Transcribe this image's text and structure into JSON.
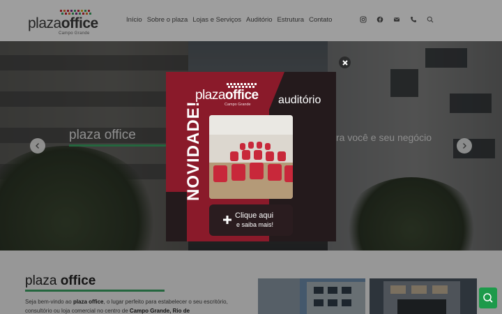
{
  "header": {
    "logo": {
      "word1": "plaza",
      "word2": "office",
      "sub": "Campo Grande"
    },
    "nav": [
      "Início",
      "Sobre o plaza",
      "Lojas e Serviços",
      "Auditório",
      "Estrutura",
      "Contato"
    ],
    "icons": [
      "instagram-icon",
      "facebook-icon",
      "email-icon",
      "phone-icon",
      "search-icon"
    ]
  },
  "hero": {
    "title": "plaza office",
    "tagline": "ra você e seu negócio"
  },
  "popup": {
    "logo_word1": "plaza",
    "logo_word2": "office",
    "logo_sub": "Campo Grande",
    "heading": "auditório",
    "vertical": "NOVIDADE!",
    "button_line1": "Clique aqui",
    "button_line2": "e saiba mais!"
  },
  "content": {
    "title_word1": "plaza",
    "title_word2": "office",
    "text_pre": "Seja bem-vindo ao ",
    "text_bold": "plaza office",
    "text_mid": ", o lugar perfeito para estabelecer o seu escritório, consultório ou loja comercial no centro de ",
    "text_bold2": "Campo Grande, Rio de"
  },
  "colors": {
    "accent_green": "#3aa565",
    "popup_red": "#8a1a2a",
    "popup_dark": "#241a1c",
    "whatsapp_green": "#1d9a4a"
  }
}
